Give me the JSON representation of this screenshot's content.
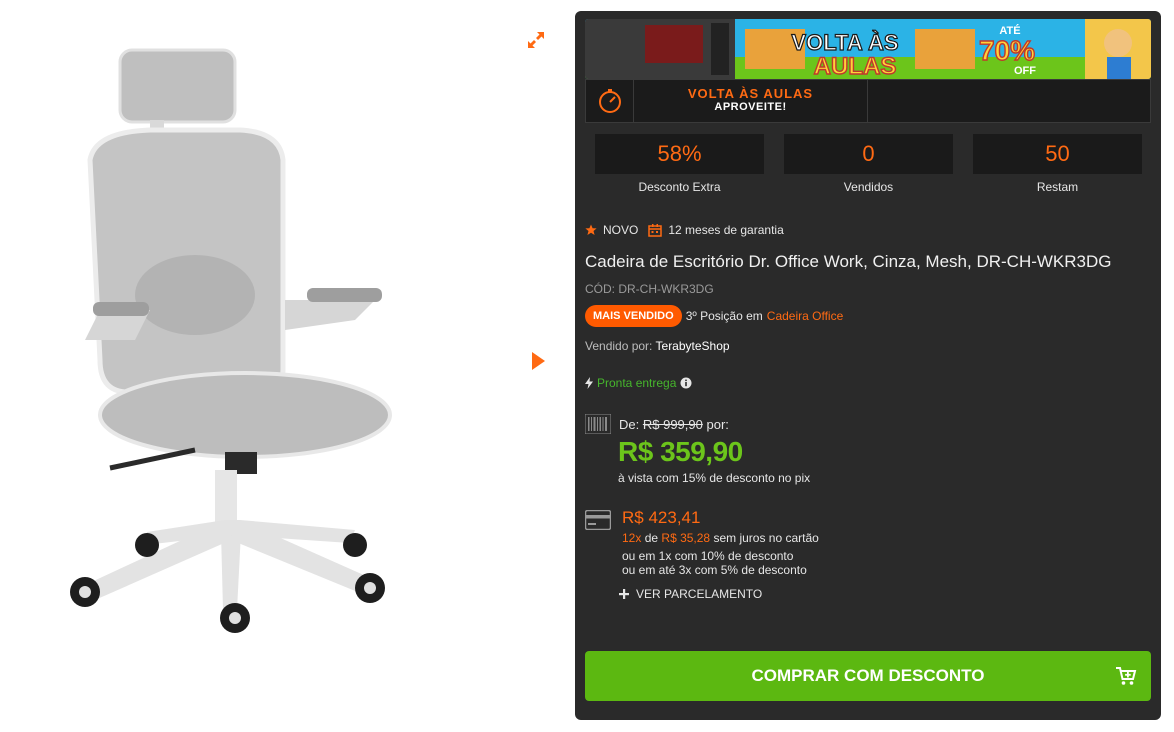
{
  "banner": {
    "headline_1": "VOLTA ÀS",
    "headline_2": "AULAS",
    "discount_prefix": "ATÉ",
    "discount_value": "70%",
    "discount_suffix": "OFF"
  },
  "promo": {
    "title": "VOLTA ÀS AULAS",
    "subtitle": "APROVEITE!"
  },
  "stats": [
    {
      "value": "58%",
      "label": "Desconto Extra"
    },
    {
      "value": "0",
      "label": "Vendidos"
    },
    {
      "value": "50",
      "label": "Restam"
    }
  ],
  "badges": {
    "condition": "NOVO",
    "warranty": "12 meses de garantia"
  },
  "product": {
    "title": "Cadeira de Escritório Dr. Office Work, Cinza, Mesh, DR-CH-WKR3DG",
    "code": "CÓD: DR-CH-WKR3DG",
    "rank_badge": "MAIS VENDIDO",
    "rank_text": "3º Posição em",
    "rank_category": "Cadeira Office",
    "seller_label": "Vendido por:",
    "seller_name": "TerabyteShop",
    "stock": "Pronta entrega"
  },
  "pricing": {
    "old_label": "De:",
    "old_price": "R$ 999,90",
    "old_suffix": "por:",
    "price": "R$ 359,90",
    "price_note": "à vista com 15% de desconto no pix",
    "card_price": "R$ 423,41",
    "installments": "12x",
    "installment_connector": "de",
    "installment_value": "R$ 35,28",
    "installment_suffix": "sem juros no cartão",
    "alt_1": "ou em 1x com 10% de desconto",
    "alt_2": "ou em até 3x com 5% de desconto",
    "more_link": "VER PARCELAMENTO"
  },
  "buy_button": "COMPRAR COM DESCONTO",
  "colors": {
    "accent_orange": "#ff6a13",
    "price_green": "#6cc51b",
    "button_green": "#5cb811",
    "panel_bg": "#2a2a2a"
  }
}
